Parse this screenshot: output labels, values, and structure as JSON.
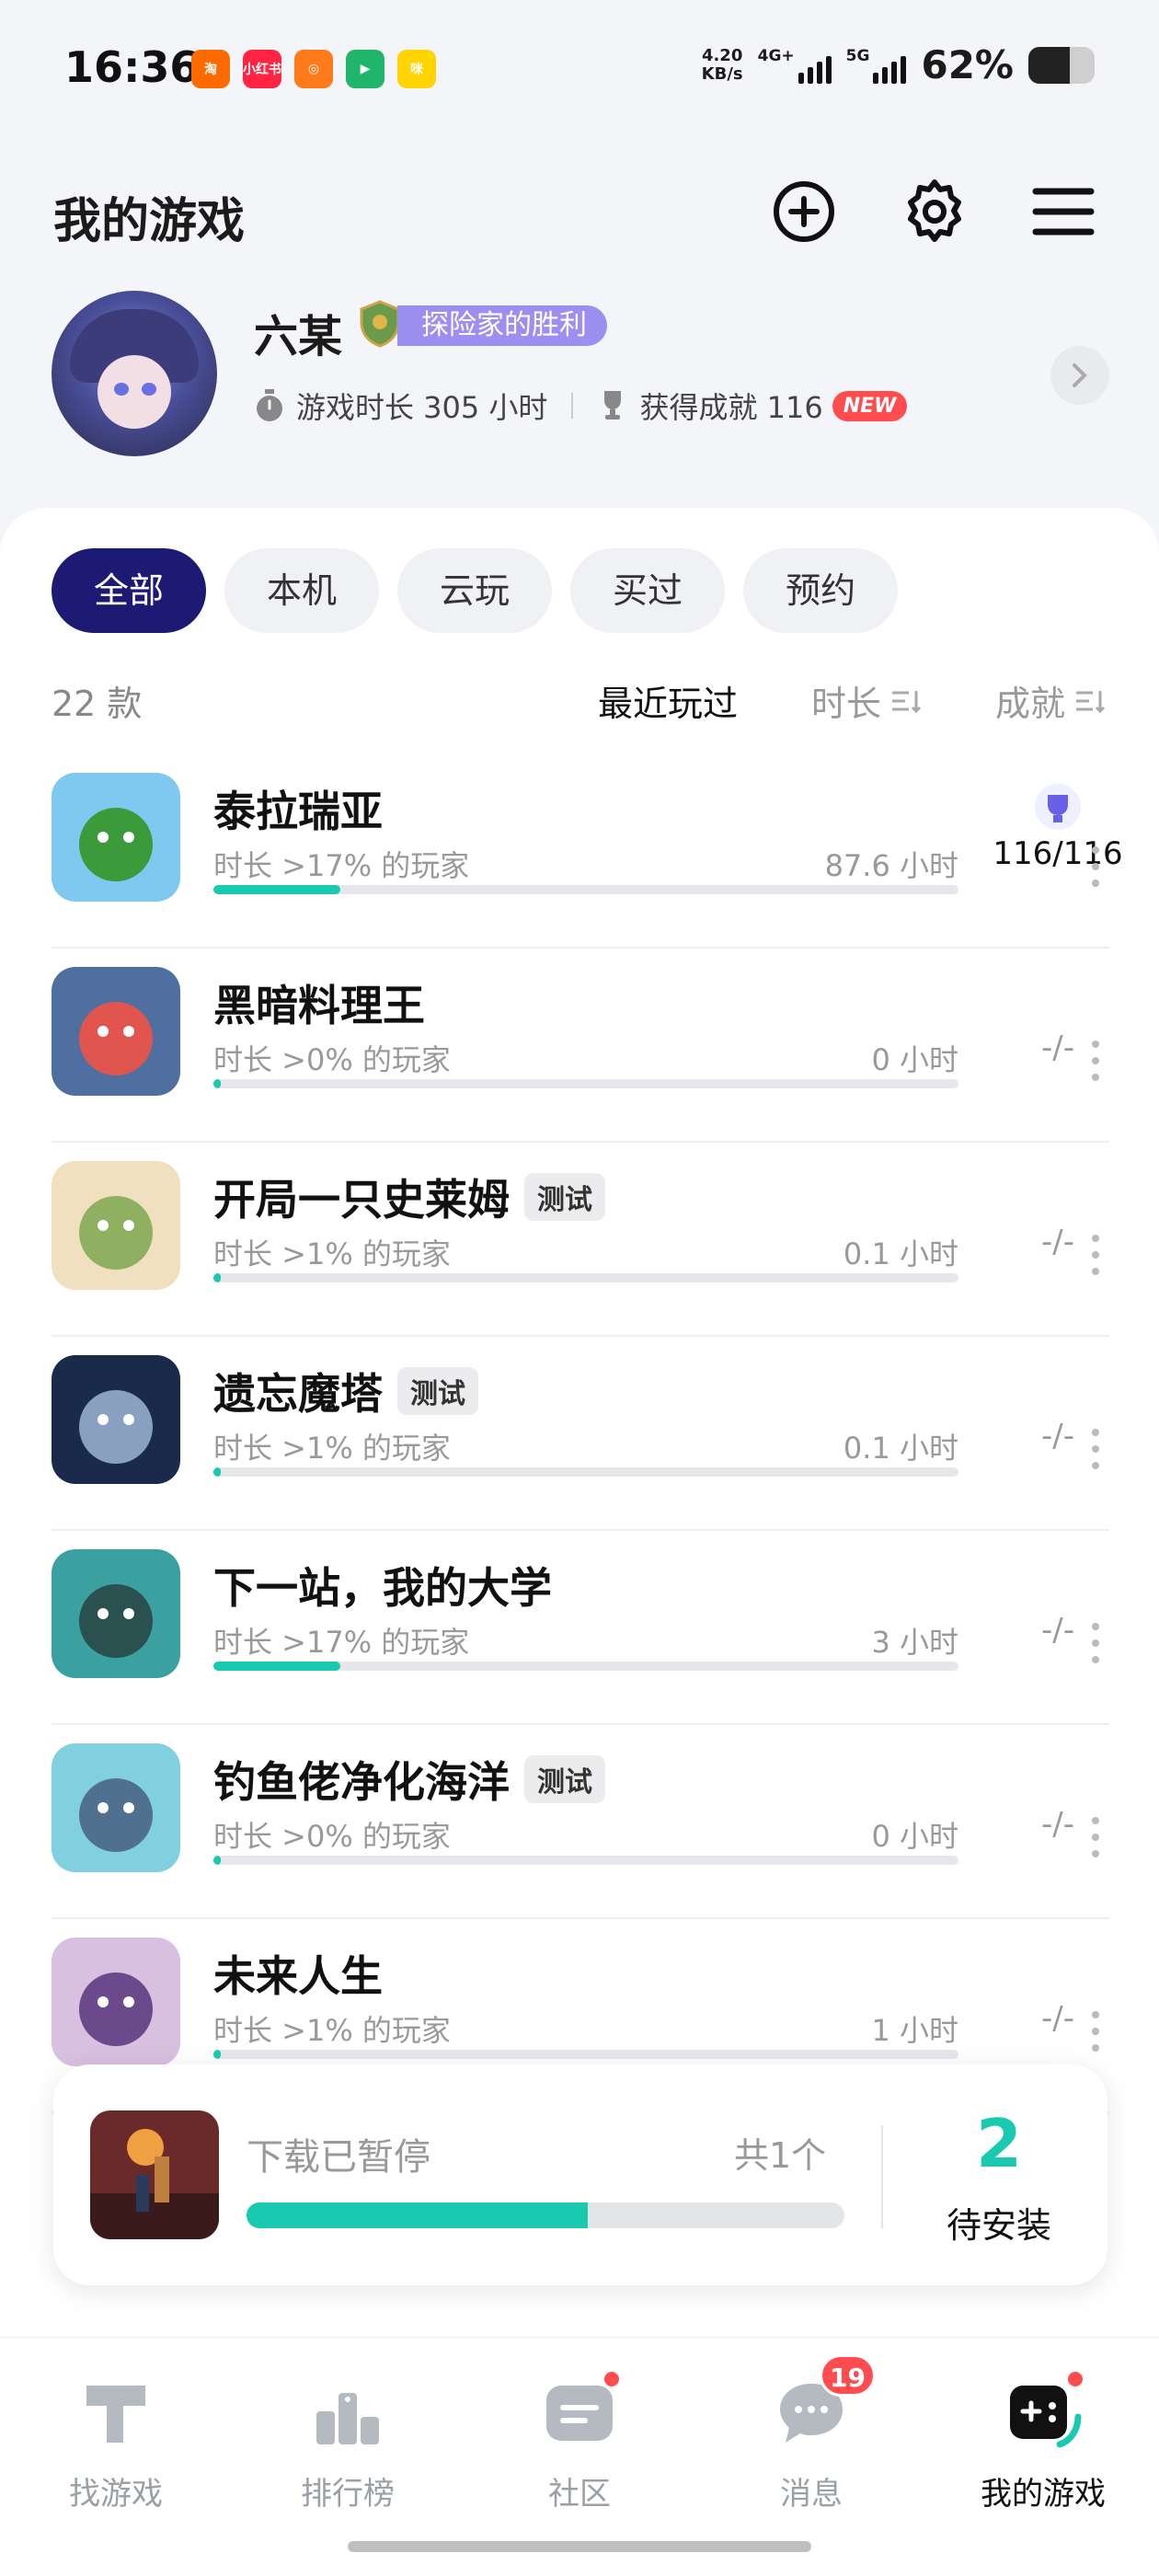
{
  "status_bar": {
    "time": "16:36",
    "app_icons": [
      {
        "name": "taobao-icon",
        "label": "淘",
        "color": "#ff6a00"
      },
      {
        "name": "xiaohongshu-icon",
        "label": "小红书",
        "color": "#ff2442"
      },
      {
        "name": "orange-app-icon",
        "label": "◎",
        "color": "#ff7a1a"
      },
      {
        "name": "video-app-icon",
        "label": "▶",
        "color": "#1fb56a"
      },
      {
        "name": "yellow-app-icon",
        "label": "咪",
        "color": "#ffd400"
      }
    ],
    "net_speed_value": "4.20",
    "net_speed_unit": "KB/s",
    "network_4g": "4G+",
    "network_5g": "5G",
    "battery": "62%",
    "battery_level": 0.62
  },
  "header": {
    "title": "我的游戏"
  },
  "profile": {
    "username": "六某",
    "title_badge": "探险家的胜利",
    "play_time": "游戏时长 305 小时",
    "achievements": "获得成就 116",
    "new_label": "NEW"
  },
  "filters": [
    "全部",
    "本机",
    "云玩",
    "买过",
    "预约"
  ],
  "active_filter": "全部",
  "list_header": {
    "count": "22 款",
    "sort_recent": "最近玩过",
    "sort_duration": "时长",
    "sort_achievement": "成就"
  },
  "games": [
    {
      "name": "泰拉瑞亚",
      "tag": "",
      "percentile": "时长 >17% 的玩家",
      "hours": "87.6 小时",
      "progress": 0.17,
      "achievement": "116/116",
      "achievement_full": true,
      "icon_colors": [
        "#7fc8f0",
        "#3b9a3a"
      ]
    },
    {
      "name": "黑暗料理王",
      "tag": "",
      "percentile": "时长 >0% 的玩家",
      "hours": "0 小时",
      "progress": 0.0,
      "achievement": "-/-",
      "achievement_full": false,
      "icon_colors": [
        "#4f6fa0",
        "#e0564f"
      ]
    },
    {
      "name": "开局一只史莱姆",
      "tag": "测试",
      "percentile": "时长 >1% 的玩家",
      "hours": "0.1 小时",
      "progress": 0.01,
      "achievement": "-/-",
      "achievement_full": false,
      "icon_colors": [
        "#f0e0c0",
        "#8fb060"
      ]
    },
    {
      "name": "遗忘魔塔",
      "tag": "测试",
      "percentile": "时长 >1% 的玩家",
      "hours": "0.1 小时",
      "progress": 0.01,
      "achievement": "-/-",
      "achievement_full": false,
      "icon_colors": [
        "#1a2a4a",
        "#8aa0c0"
      ]
    },
    {
      "name": "下一站，我的大学",
      "tag": "",
      "percentile": "时长 >17% 的玩家",
      "hours": "3 小时",
      "progress": 0.17,
      "achievement": "-/-",
      "achievement_full": false,
      "icon_colors": [
        "#3aa0a0",
        "#2a5050"
      ]
    },
    {
      "name": "钓鱼佬净化海洋",
      "tag": "测试",
      "percentile": "时长 >0% 的玩家",
      "hours": "0 小时",
      "progress": 0.0,
      "achievement": "-/-",
      "achievement_full": false,
      "icon_colors": [
        "#80d0e0",
        "#507090"
      ]
    },
    {
      "name": "未来人生",
      "tag": "",
      "percentile": "时长 >1% 的玩家",
      "hours": "1 小时",
      "progress": 0.01,
      "achievement": "-/-",
      "achievement_full": false,
      "icon_colors": [
        "#d8c0e0",
        "#6a4a8a"
      ]
    }
  ],
  "download": {
    "status": "下载已暂停",
    "total": "共1个",
    "progress": 0.57,
    "pending_count": "2",
    "pending_label": "待安装"
  },
  "bottom_nav": [
    {
      "label": "找游戏",
      "name": "nav-find-games",
      "active": false
    },
    {
      "label": "排行榜",
      "name": "nav-rankings",
      "active": false
    },
    {
      "label": "社区",
      "name": "nav-community",
      "active": false
    },
    {
      "label": "消息",
      "name": "nav-messages",
      "active": false,
      "badge": "19"
    },
    {
      "label": "我的游戏",
      "name": "nav-my-games",
      "active": true
    }
  ],
  "colors": {
    "accent": "#19c9b0",
    "active_chip": "#1d1a73",
    "badge_red": "#ff4d4f",
    "title_badge": "#9d8ff0"
  }
}
